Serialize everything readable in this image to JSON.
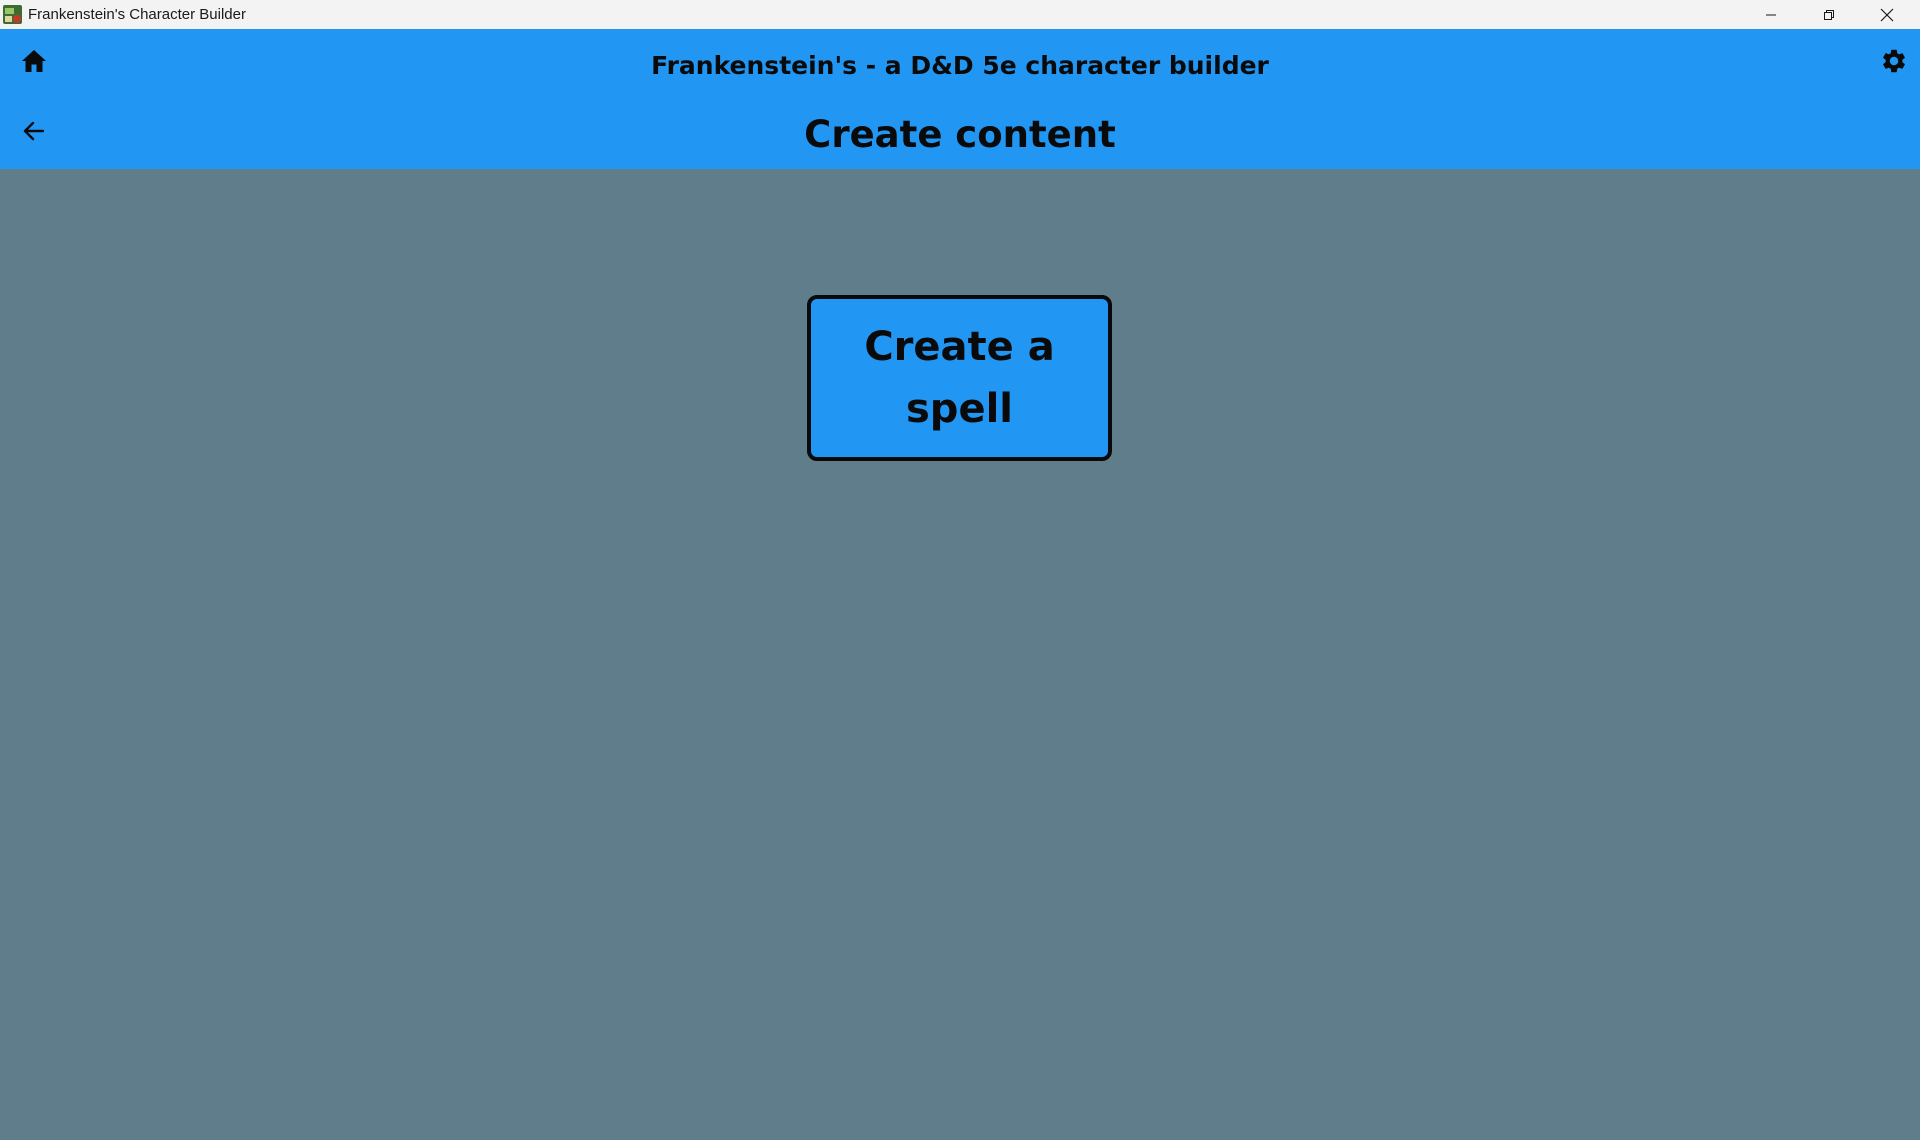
{
  "window": {
    "title": "Frankenstein's Character Builder",
    "icon": "app-icon"
  },
  "appbar": {
    "title": "Frankenstein's - a D&D 5e character builder",
    "page_title": "Create content",
    "home_icon": "home-icon",
    "settings_icon": "gear-icon",
    "back_icon": "arrow-left-icon"
  },
  "content": {
    "create_spell_label": "Create a spell"
  },
  "colors": {
    "appbar": "#2196f3",
    "background": "#607d8b",
    "button": "#2196f3",
    "text": "#0a0a0a"
  }
}
